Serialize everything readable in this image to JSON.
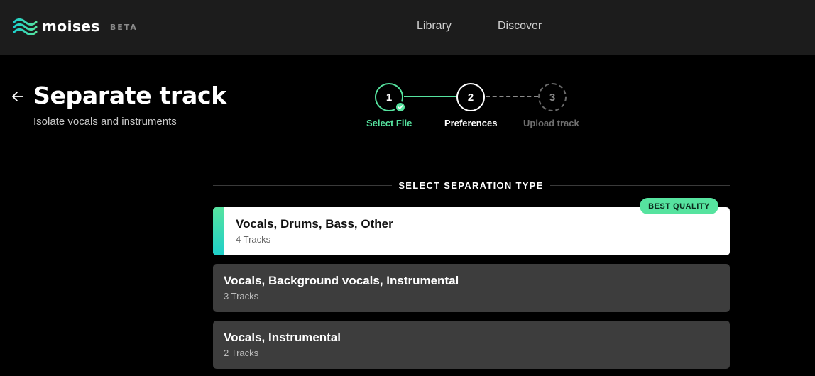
{
  "header": {
    "brand": "moises",
    "beta_label": "BETA",
    "nav": [
      {
        "label": "Library"
      },
      {
        "label": "Discover"
      }
    ]
  },
  "page": {
    "title": "Separate track",
    "subtitle": "Isolate vocals and instruments"
  },
  "stepper": {
    "steps": [
      {
        "number": "1",
        "label": "Select File",
        "state": "complete"
      },
      {
        "number": "2",
        "label": "Preferences",
        "state": "current"
      },
      {
        "number": "3",
        "label": "Upload track",
        "state": "upcoming"
      }
    ]
  },
  "section": {
    "heading": "SELECT SEPARATION TYPE"
  },
  "options": [
    {
      "title": "Vocals, Drums, Bass, Other",
      "tracks": "4 Tracks",
      "badge": "BEST QUALITY",
      "selected": true
    },
    {
      "title": "Vocals, Background vocals, Instrumental",
      "tracks": "3 Tracks",
      "selected": false
    },
    {
      "title": "Vocals, Instrumental",
      "tracks": "2 Tracks",
      "selected": false
    }
  ],
  "colors": {
    "accent_green": "#56e39f",
    "accent_teal": "#1ecfc9",
    "topbar": "#1c1c1c",
    "card_dark": "#3d3d3d"
  },
  "icons": {
    "logo": "moises-wave-icon",
    "back": "arrow-left-icon",
    "check": "check-icon"
  }
}
